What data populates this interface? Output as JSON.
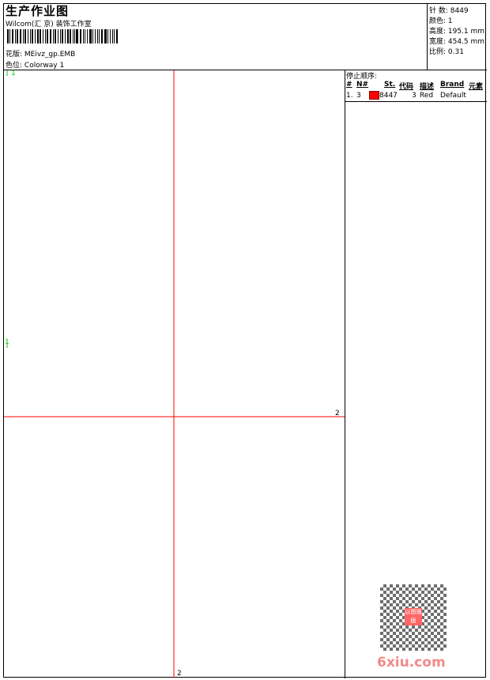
{
  "header": {
    "title": "生产作业图",
    "company": "Wilcom(汇 京) 装饰工作室",
    "design_label": "花版:",
    "design_value": "MEivz_gp.EMB",
    "colorway_label": "色位:",
    "colorway_value": "Colorway 1"
  },
  "info": {
    "stitches": "针 数: 8449",
    "colors": "颜色: 1",
    "height": "高度: 195.1 mm",
    "width": "宽度: 454.5 mm",
    "scale": "比例: 0.31"
  },
  "stop_sequence": {
    "title": "停止顺序:",
    "headers": [
      "#",
      "N#",
      "St.",
      "代码",
      "描述",
      "Brand",
      "元素"
    ],
    "rows": [
      {
        "num": "1.",
        "n": "3",
        "color": "#ff0000",
        "st": "8447",
        "code": "3",
        "desc": "Red",
        "brand": "Default"
      }
    ]
  },
  "canvas": {
    "marker_top": "1",
    "marker_left": "1",
    "marker_right": "2",
    "marker_bottom": "2",
    "design_color": "#ff0000",
    "guide_color": "#ff0000",
    "marker_color": "#00cc00"
  },
  "watermark": {
    "text": "6xiu.com",
    "seal": "以图搜版"
  }
}
